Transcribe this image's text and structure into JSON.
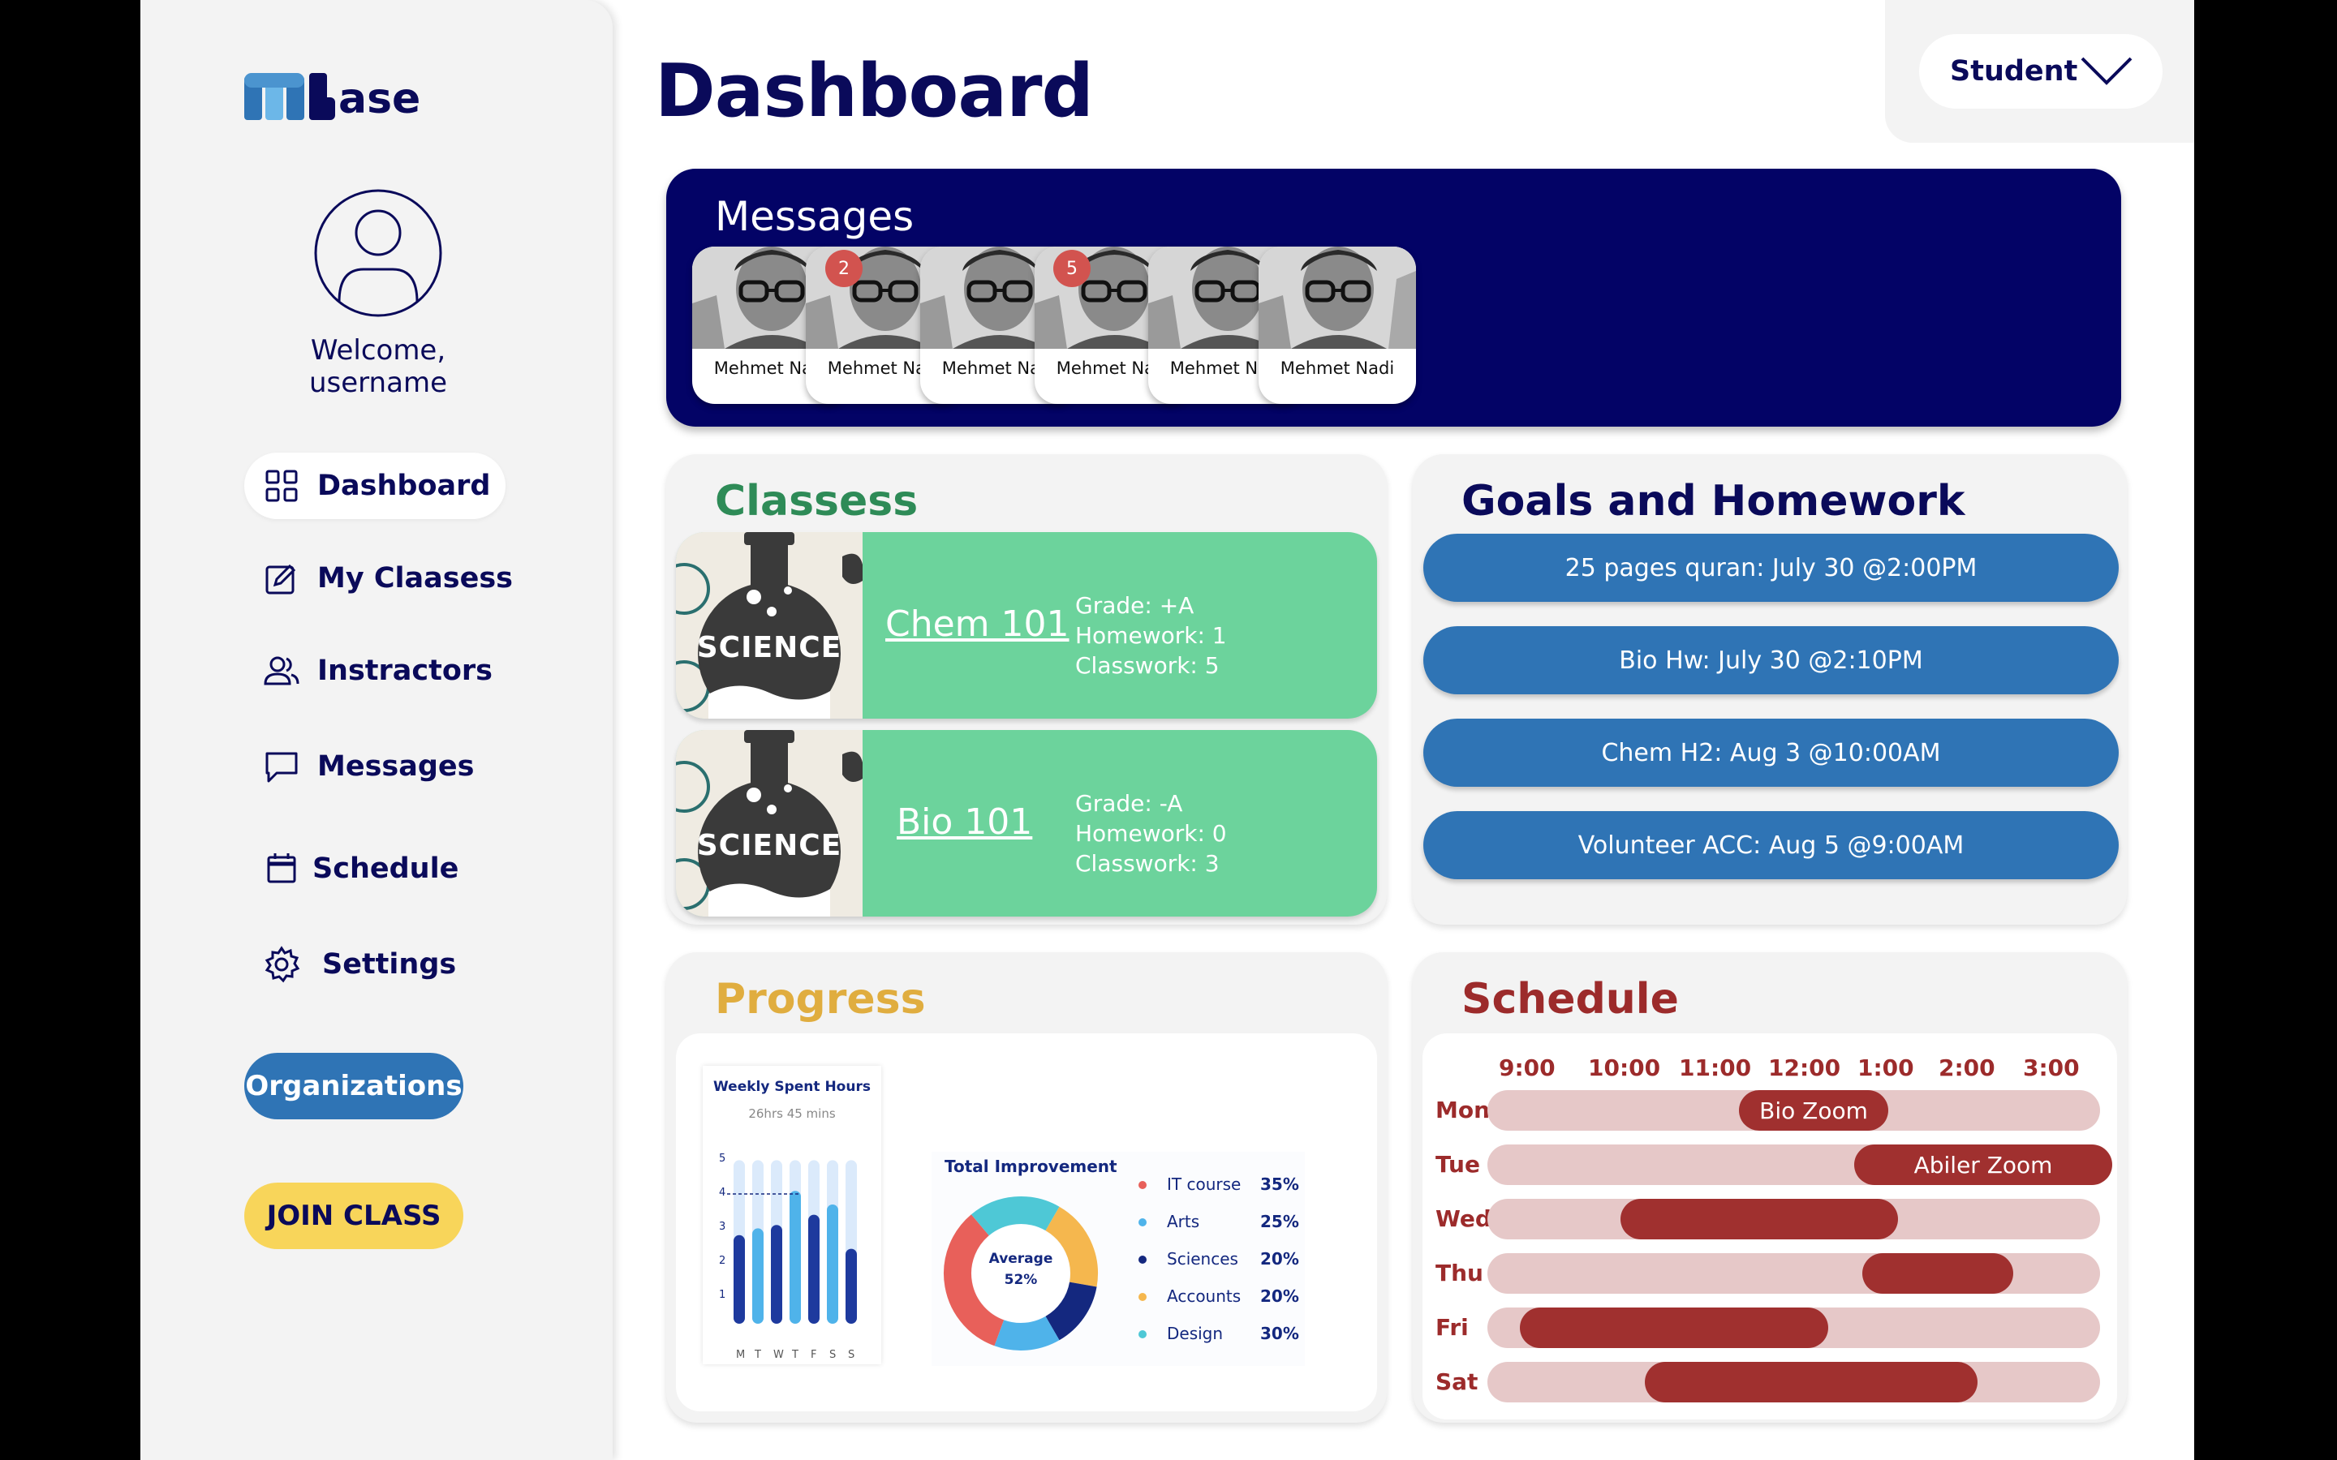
{
  "app": {
    "logo_text": "ase"
  },
  "sidebar": {
    "welcome": "Welcome, username",
    "nav": [
      {
        "label": "Dashboard",
        "icon": "grid-icon"
      },
      {
        "label": "My Claasess",
        "icon": "edit-square-icon"
      },
      {
        "label": "Instractors",
        "icon": "users-icon"
      },
      {
        "label": "Messages",
        "icon": "chat-icon"
      },
      {
        "label": "Schedule",
        "icon": "calendar-icon"
      },
      {
        "label": "Settings",
        "icon": "gear-icon"
      }
    ],
    "organizations_label": "Organizations",
    "join_label": "JOIN CLASS"
  },
  "header": {
    "title": "Dashboard",
    "role": "Student"
  },
  "messages": {
    "title": "Messages",
    "contacts": [
      {
        "name": "Mehmet Nadi",
        "badge": "2"
      },
      {
        "name": "Mehmet Nadi",
        "badge": ""
      },
      {
        "name": "Mehmet Nadi",
        "badge": "5"
      },
      {
        "name": "Mehmet Nadi",
        "badge": ""
      },
      {
        "name": "Mehmet Nadi",
        "badge": ""
      },
      {
        "name": "Mehmet Nadi",
        "badge": ""
      }
    ]
  },
  "classes": {
    "title": "Classess",
    "image_text": "SCIENCE",
    "items": [
      {
        "name": "Chem 101",
        "grade": "Grade: +A",
        "homework": "Homework: 1",
        "classwork": "Classwork: 5"
      },
      {
        "name": "Bio 101",
        "grade": "Grade: -A",
        "homework": "Homework: 0",
        "classwork": "Classwork: 3"
      }
    ]
  },
  "goals": {
    "title": "Goals and Homework",
    "items": [
      "25 pages quran: July 30 @2:00PM",
      "Bio Hw: July 30 @2:10PM",
      "Chem H2: Aug 3 @10:00AM",
      "Volunteer ACC: Aug 5 @9:00AM"
    ]
  },
  "progress": {
    "title": "Progress",
    "weekly": {
      "title": "Weekly Spent Hours",
      "subtitle": "26hrs 45 mins",
      "y_ticks": [
        "5",
        "4",
        "3",
        "2",
        "1"
      ],
      "days": [
        "M",
        "T",
        "W",
        "T",
        "F",
        "S",
        "S"
      ]
    },
    "total": {
      "title": "Total Improvement",
      "center_label": "Average",
      "center_value": "52%",
      "legend": [
        {
          "label": "IT course",
          "value": "35%",
          "color": "#e8605a"
        },
        {
          "label": "Arts",
          "value": "25%",
          "color": "#4fb3ea"
        },
        {
          "label": "Sciences",
          "value": "20%",
          "color": "#14287f"
        },
        {
          "label": "Accounts",
          "value": "20%",
          "color": "#f5b74e"
        },
        {
          "label": "Design",
          "value": "30%",
          "color": "#4ec8d6"
        }
      ]
    }
  },
  "schedule": {
    "title": "Schedule",
    "times": [
      "9:00",
      "10:00",
      "11:00",
      "12:00",
      "1:00",
      "2:00",
      "3:00"
    ],
    "days": [
      {
        "day": "Mon",
        "event": "Bio Zoom"
      },
      {
        "day": "Tue",
        "event": "Abiler Zoom"
      },
      {
        "day": "Wed",
        "event": ""
      },
      {
        "day": "Thu",
        "event": ""
      },
      {
        "day": "Fri",
        "event": ""
      },
      {
        "day": "Sat",
        "event": ""
      }
    ]
  }
}
